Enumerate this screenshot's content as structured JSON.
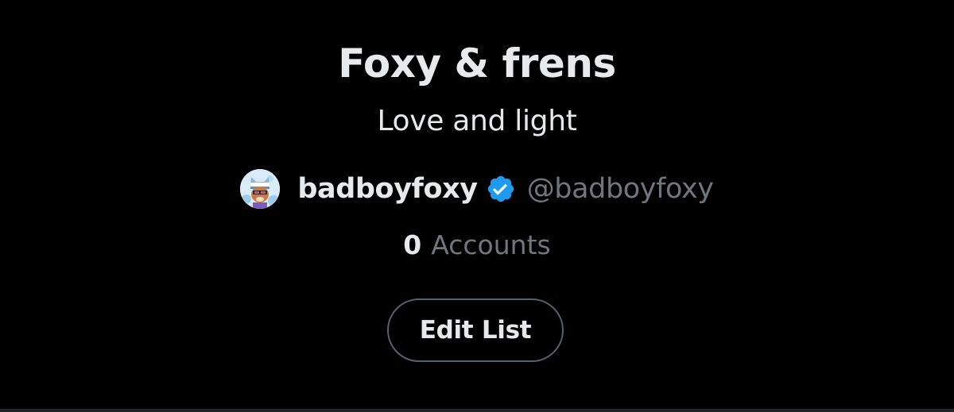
{
  "list": {
    "title": "Foxy & frens",
    "description": "Love and light"
  },
  "owner": {
    "name": "badboyfoxy",
    "handle": "@badboyfoxy",
    "verified": true,
    "verified_icon": "verified-badge-icon",
    "avatar_icon": "avatar"
  },
  "accounts": {
    "count": "0",
    "label": "Accounts"
  },
  "actions": {
    "edit_label": "Edit List"
  },
  "colors": {
    "background": "#000000",
    "primary_text": "#e7e9ea",
    "secondary_text": "#71767b",
    "verified_blue": "#1d9bf0",
    "button_border": "#536471"
  }
}
